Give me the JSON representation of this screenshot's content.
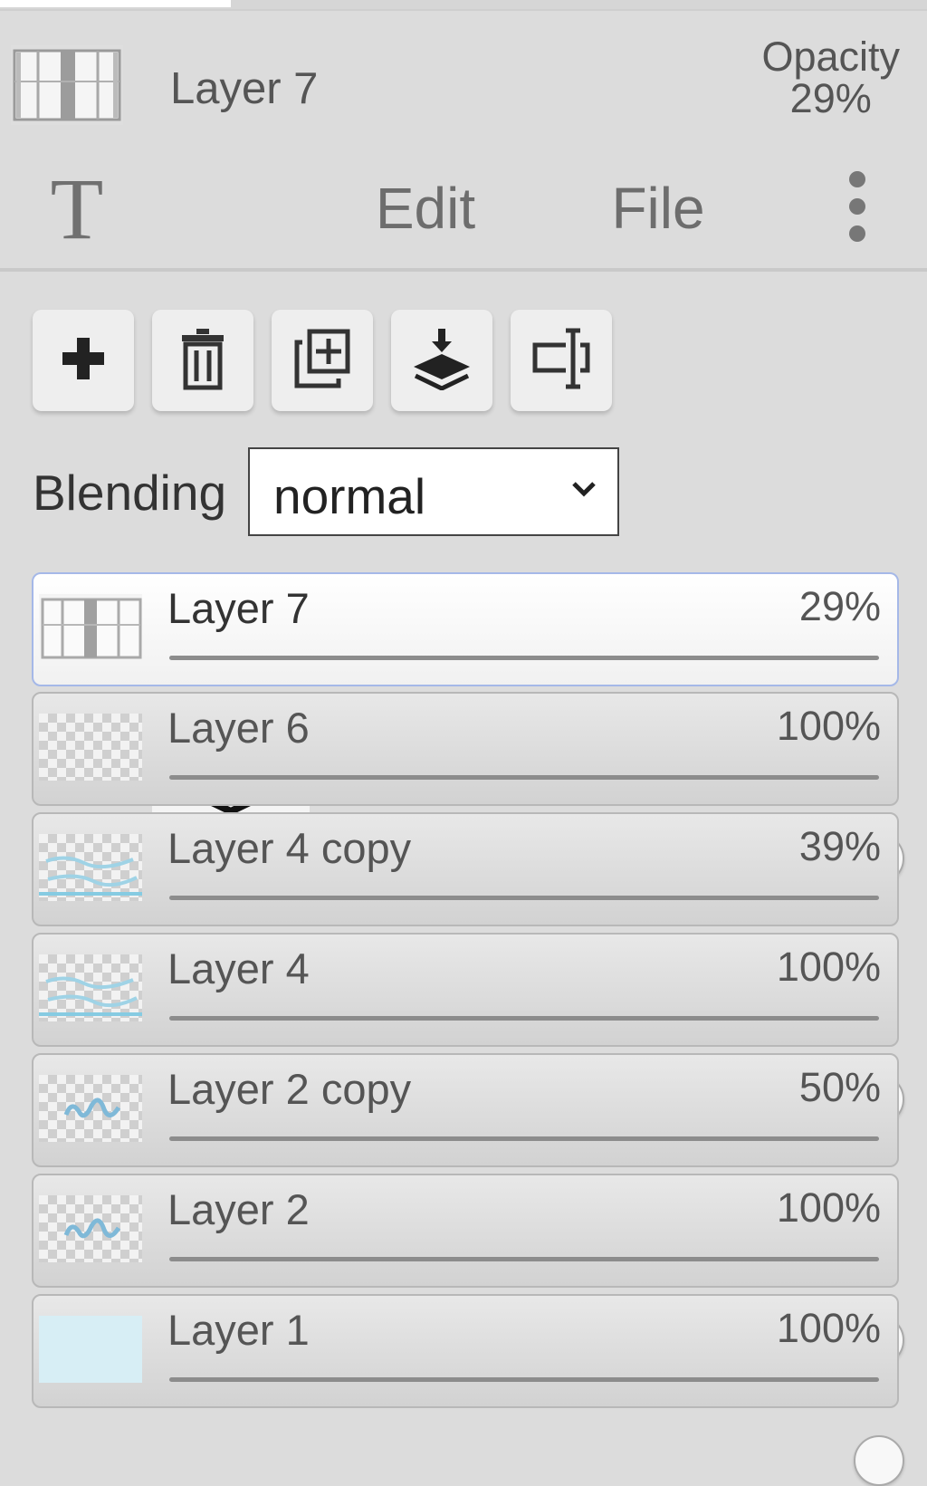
{
  "header": {
    "current_layer_name": "Layer 7",
    "opacity_label": "Opacity",
    "opacity_value": "29%"
  },
  "tabs": [
    {
      "label": "T",
      "icon": "text-tool-icon",
      "active": false
    },
    {
      "label": "",
      "icon": "layers-icon",
      "active": true
    },
    {
      "label": "Edit",
      "active": false
    },
    {
      "label": "File",
      "active": false
    },
    {
      "label": "",
      "icon": "more-vertical-icon",
      "active": false
    }
  ],
  "toolbar": {
    "buttons": [
      {
        "icon": "add-layer-icon"
      },
      {
        "icon": "trash-icon"
      },
      {
        "icon": "duplicate-layer-icon"
      },
      {
        "icon": "merge-down-icon"
      },
      {
        "icon": "rename-layer-icon"
      }
    ]
  },
  "blending": {
    "label": "Blending",
    "value": "normal"
  },
  "layers": [
    {
      "name": "Layer 7",
      "opacity": "29%",
      "opacity_value": 0.29,
      "active": true,
      "thumb": "window-image"
    },
    {
      "name": "Layer 6",
      "opacity": "100%",
      "opacity_value": 1.0,
      "active": false,
      "thumb": "transparent"
    },
    {
      "name": "Layer 4 copy",
      "opacity": "39%",
      "opacity_value": 0.39,
      "active": false,
      "thumb": "transparent-blue"
    },
    {
      "name": "Layer 4",
      "opacity": "100%",
      "opacity_value": 1.0,
      "active": false,
      "thumb": "transparent-blue"
    },
    {
      "name": "Layer 2 copy",
      "opacity": "50%",
      "opacity_value": 0.5,
      "active": false,
      "thumb": "transparent-text"
    },
    {
      "name": "Layer 2",
      "opacity": "100%",
      "opacity_value": 1.0,
      "active": false,
      "thumb": "transparent-text"
    },
    {
      "name": "Layer 1",
      "opacity": "100%",
      "opacity_value": 1.0,
      "active": false,
      "thumb": "light-blue-fill"
    }
  ],
  "colors": {
    "panel_bg": "#dcdcdc",
    "active_layer_border": "#a5b8e8",
    "layer1_fill": "#d7eef5"
  }
}
